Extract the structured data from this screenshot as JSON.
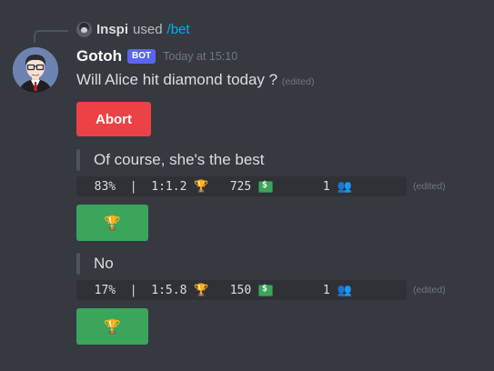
{
  "reply": {
    "user": "Inspi",
    "used_text": "used",
    "command": "/bet",
    "avatar_icon": "user-avatar"
  },
  "message": {
    "username": "Gotoh",
    "badge": "BOT",
    "timestamp": "Today at 15:10",
    "question": "Will Alice hit diamond today ?",
    "edited_label": "(edited)",
    "avatar_icon": "bot-avatar"
  },
  "abort_button": {
    "label": "Abort",
    "color": "#ed4245"
  },
  "options": [
    {
      "label": "Of course, she's the best",
      "percent": "83%",
      "separator": "|",
      "odds": "1:1.2",
      "amount": "725",
      "bettors": "1",
      "edited_label": "(edited)",
      "button_icon": "trophy-icon",
      "button_color": "#3ba55c"
    },
    {
      "label": "No",
      "percent": "17%",
      "separator": "|",
      "odds": "1:5.8",
      "amount": "150",
      "bettors": "1",
      "edited_label": "(edited)",
      "button_icon": "trophy-icon",
      "button_color": "#3ba55c"
    }
  ],
  "icons": {
    "odds": "trophy-icon",
    "amount": "money-icon",
    "bettors": "people-icon"
  },
  "colors": {
    "background": "#36393f",
    "link": "#00aff4",
    "bot_badge": "#5865f2",
    "code_background": "#2f3136"
  }
}
